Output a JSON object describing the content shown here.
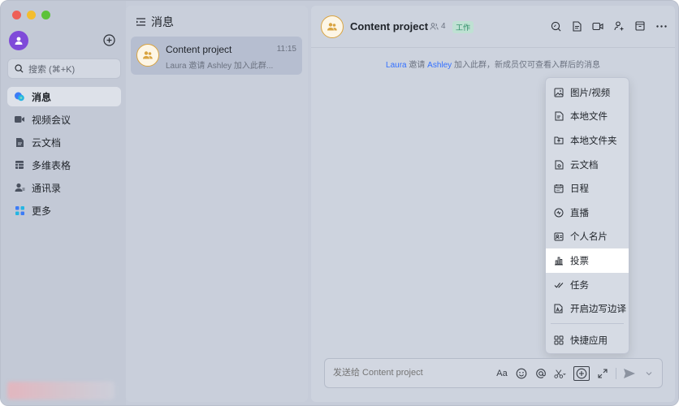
{
  "sidebar": {
    "search_placeholder": "搜索 (⌘+K)",
    "items": [
      {
        "label": "消息",
        "icon": "chat-bubbles-icon",
        "active": true
      },
      {
        "label": "视频会议",
        "icon": "video-icon",
        "active": false
      },
      {
        "label": "云文档",
        "icon": "cloud-doc-icon",
        "active": false
      },
      {
        "label": "多维表格",
        "icon": "table-icon",
        "active": false
      },
      {
        "label": "通讯录",
        "icon": "contacts-icon",
        "active": false
      },
      {
        "label": "更多",
        "icon": "more-apps-icon",
        "active": false
      }
    ]
  },
  "chatlist": {
    "title": "消息",
    "chats": [
      {
        "name": "Content project",
        "time": "11:15",
        "preview": "Laura 邀请 Ashley 加入此群..."
      }
    ]
  },
  "chat": {
    "title": "Content project",
    "member_count": "4",
    "badge": "工作",
    "system_message": {
      "inviter": "Laura",
      "verb": " 邀请 ",
      "invitee": "Ashley",
      "rest": " 加入此群，新成员仅可查看入群后的消息"
    }
  },
  "menu": {
    "items": [
      {
        "label": "图片/视频",
        "icon": "image-icon"
      },
      {
        "label": "本地文件",
        "icon": "file-icon"
      },
      {
        "label": "本地文件夹",
        "icon": "folder-icon"
      },
      {
        "label": "云文档",
        "icon": "cloud-doc-icon"
      },
      {
        "label": "日程",
        "icon": "calendar-icon"
      },
      {
        "label": "直播",
        "icon": "live-icon"
      },
      {
        "label": "个人名片",
        "icon": "contact-card-icon"
      },
      {
        "label": "投票",
        "icon": "poll-icon",
        "highlighted": true
      },
      {
        "label": "任务",
        "icon": "task-icon"
      },
      {
        "label": "开启边写边译",
        "icon": "translate-icon"
      }
    ],
    "footer": {
      "label": "快捷应用",
      "icon": "apps-grid-icon"
    }
  },
  "composer": {
    "placeholder": "发送给 Content project",
    "font_label": "Aa"
  },
  "colors": {
    "accent": "#3370ff",
    "avatar": "#7f4ad9",
    "badge_bg": "#bfe1d3",
    "badge_text": "#2a8b63"
  }
}
